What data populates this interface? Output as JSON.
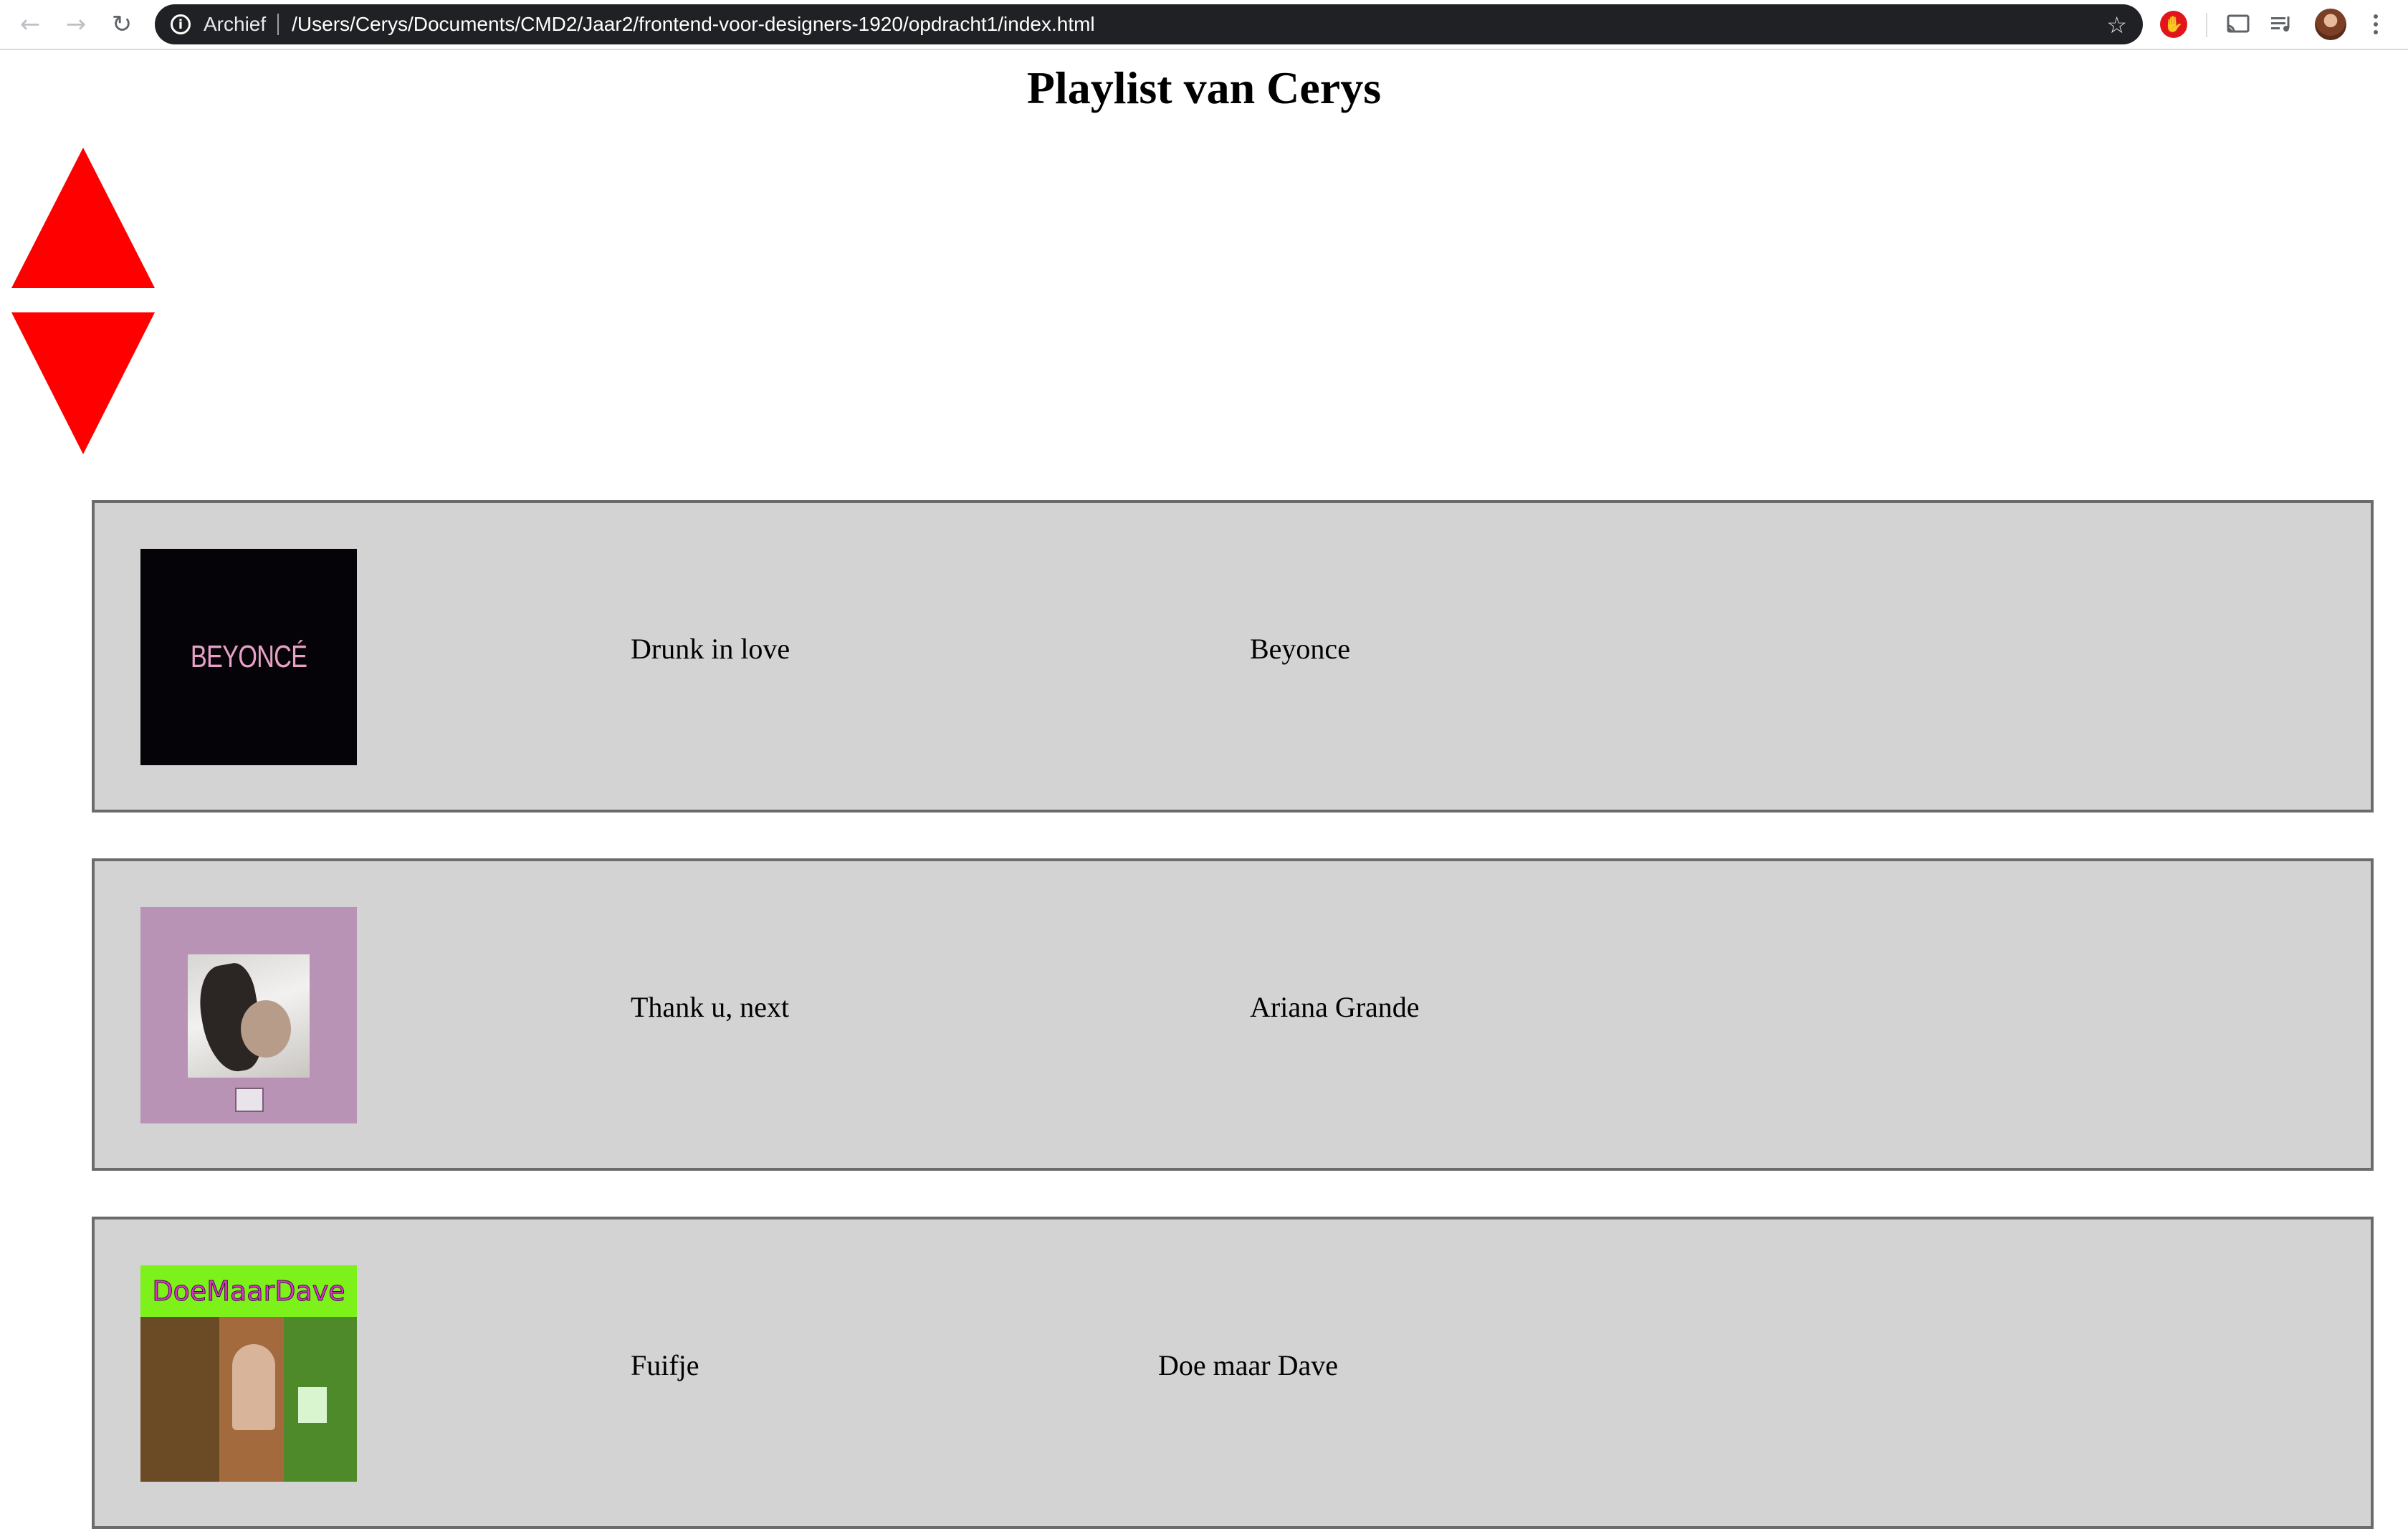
{
  "browser": {
    "location_chip": "Archief",
    "url": "/Users/Cerys/Documents/CMD2/Jaar2/frontend-voor-designers-1920/opdracht1/index.html",
    "icons": {
      "back": "back-arrow-icon",
      "forward": "forward-arrow-icon",
      "reload": "reload-icon",
      "info": "info-icon",
      "bookmark": "star-icon",
      "extension": "adblock-icon",
      "cast": "cast-icon",
      "media": "media-controls-icon",
      "profile": "avatar",
      "menu": "more-vertical-icon"
    }
  },
  "page": {
    "title": "Playlist van Cerys",
    "controls": {
      "up_color": "#ff0000",
      "down_color": "#ff0000"
    }
  },
  "playlist": [
    {
      "title": "Drunk in love",
      "artist": "Beyonce",
      "cover_text": "BEYONCÉ"
    },
    {
      "title": "Thank u, next",
      "artist": "Ariana Grande"
    },
    {
      "title": "Fuifje",
      "artist": "Doe maar Dave",
      "cover_text": "DoeMaarDave"
    }
  ],
  "colors": {
    "card_background": "#d3d3d3",
    "card_border": "#6b6b6b",
    "arrow": "#ff0000"
  }
}
